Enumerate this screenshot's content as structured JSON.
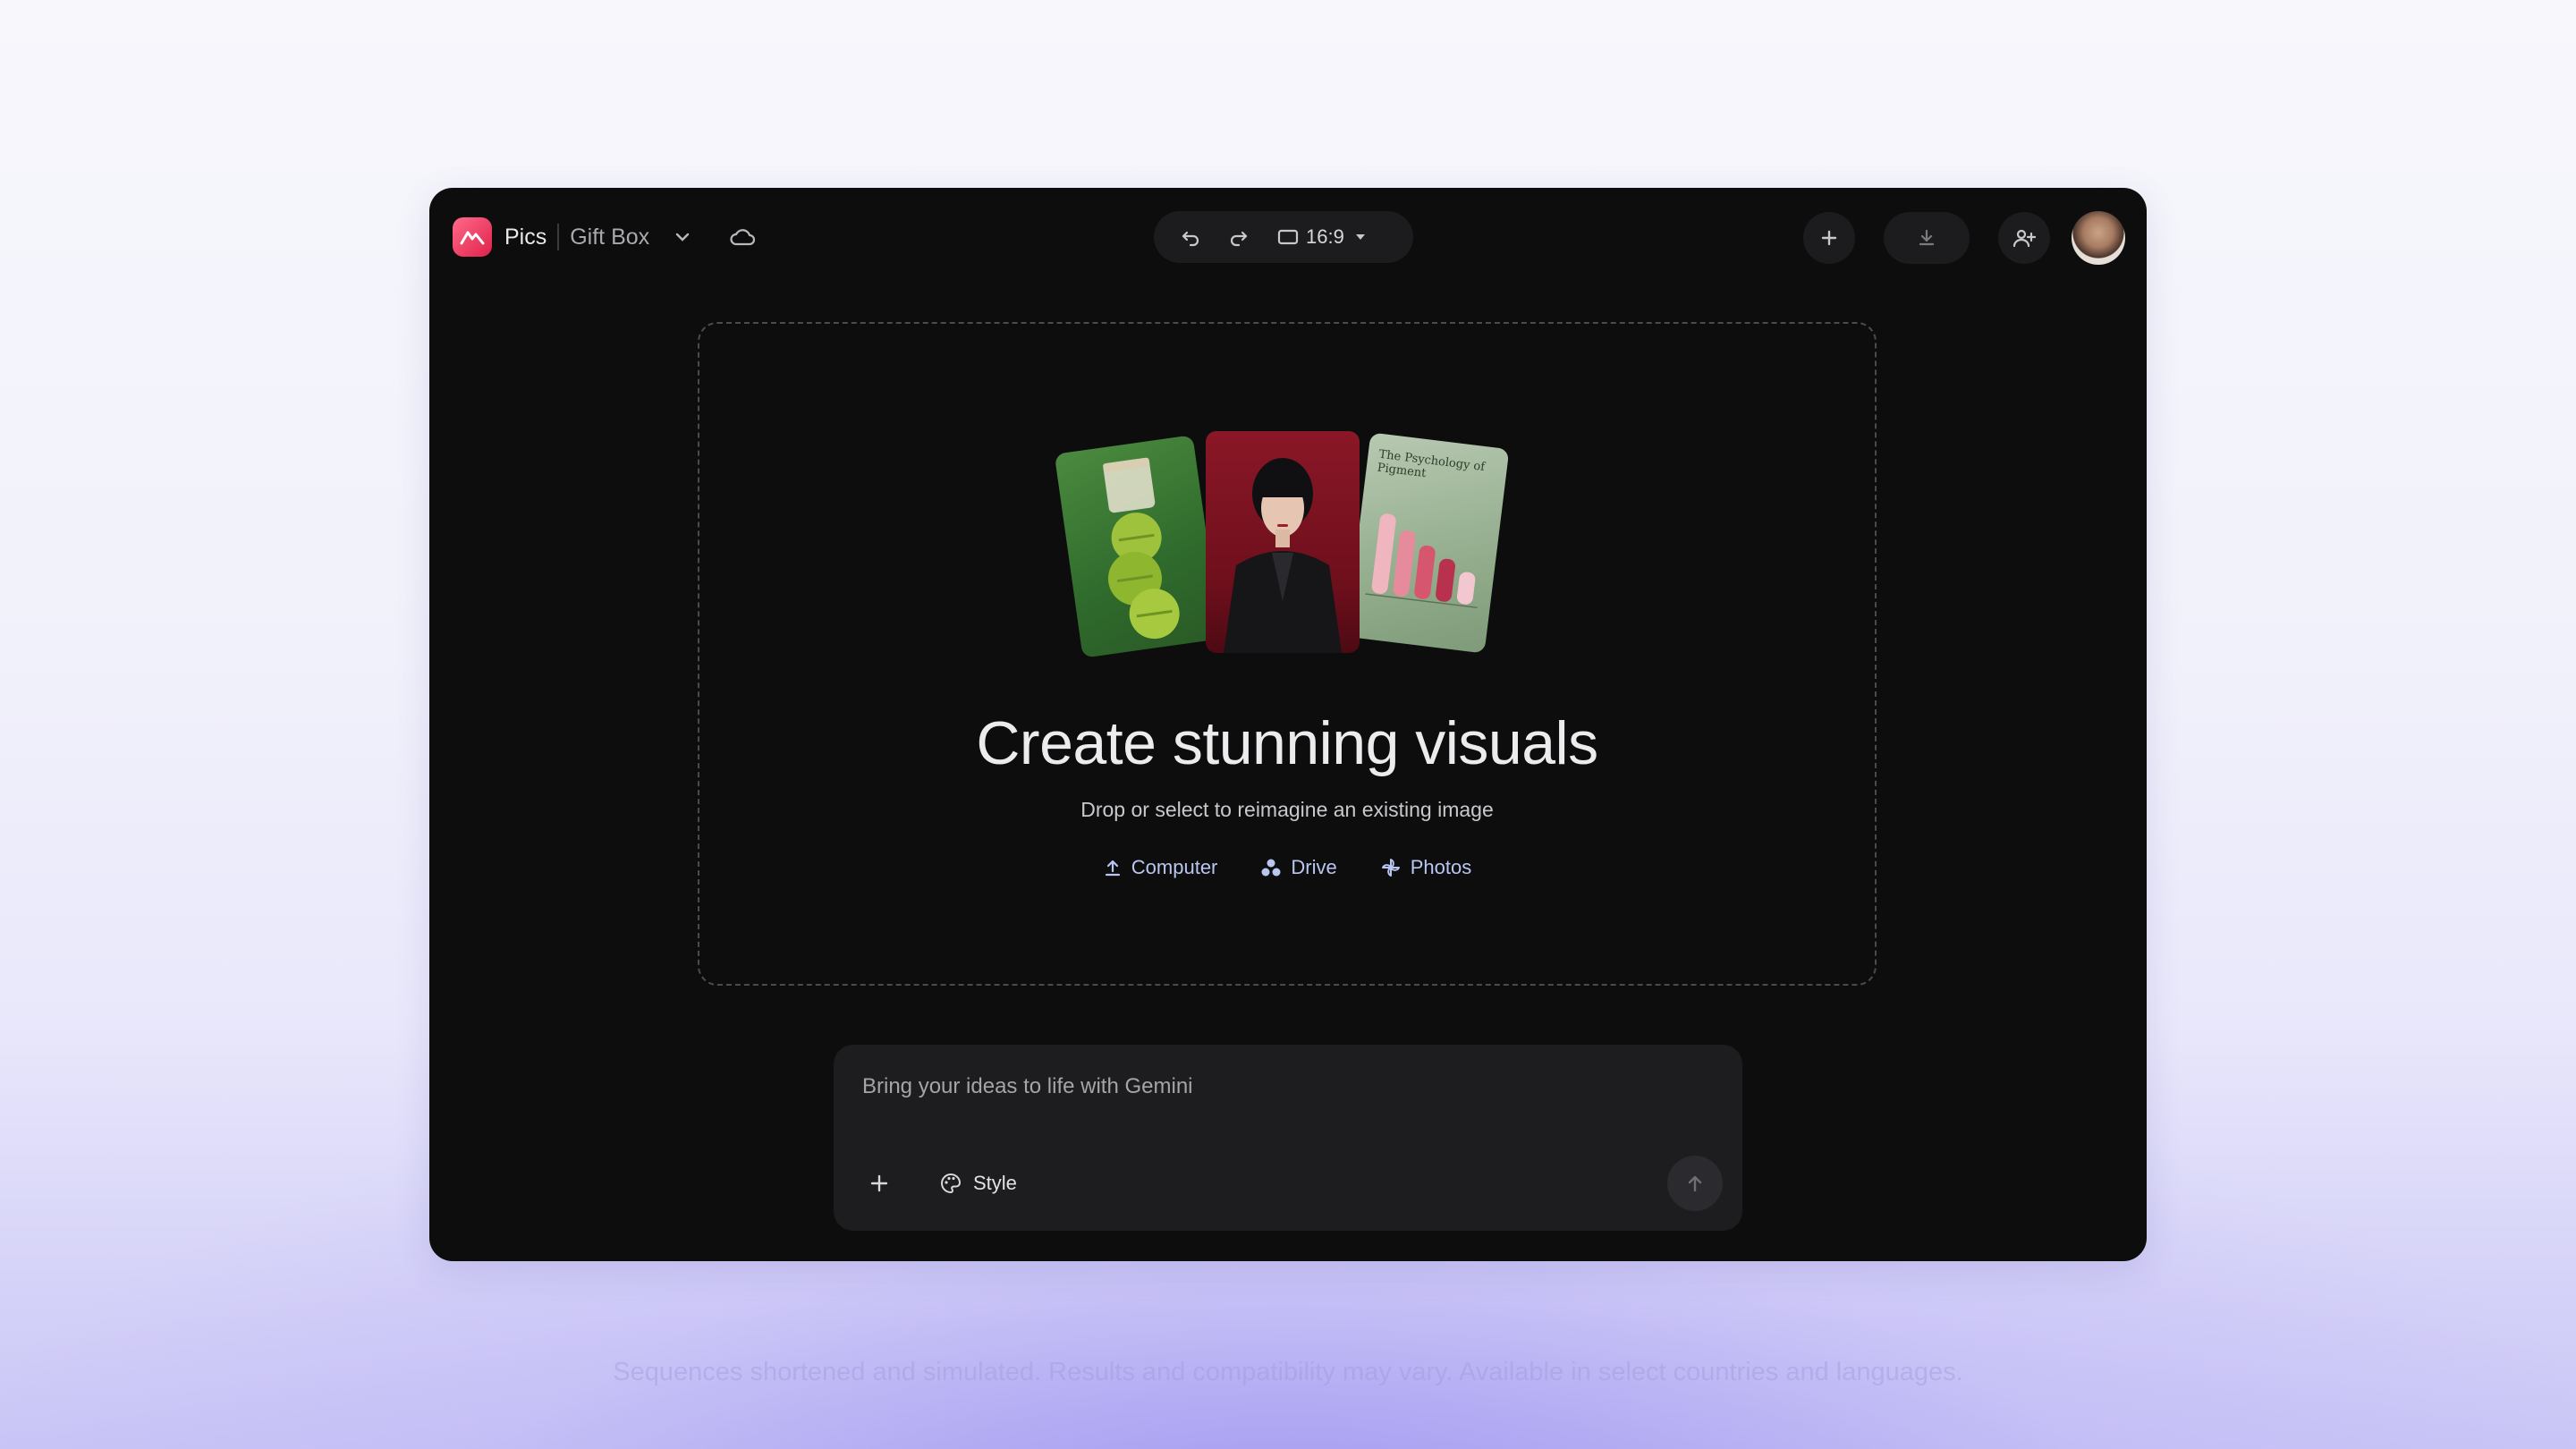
{
  "app": {
    "name": "Pics",
    "project_name": "Gift Box",
    "accent": "#e0214a"
  },
  "toolbar": {
    "aspect_ratio": "16:9",
    "icons": [
      "undo-icon",
      "redo-icon",
      "aspect-ratio-icon",
      "plus-icon",
      "download-icon",
      "add-person-icon"
    ]
  },
  "hero": {
    "cards": [
      {
        "title": ""
      },
      {
        "title": ""
      },
      {
        "title": "The Psychology of Pigment"
      }
    ],
    "title": "Create stunning visuals",
    "subtitle": "Drop or select to reimagine an existing image",
    "sources": [
      {
        "label": "Computer",
        "icon": "upload-icon"
      },
      {
        "label": "Drive",
        "icon": "drive-icon"
      },
      {
        "label": "Photos",
        "icon": "photos-icon"
      }
    ]
  },
  "prompt": {
    "placeholder": "Bring your ideas to life with Gemini",
    "value": "",
    "style_label": "Style"
  },
  "footer": {
    "disclaimer": "Sequences shortened and simulated. Results and compatibility may vary. Available in select countries and languages."
  }
}
